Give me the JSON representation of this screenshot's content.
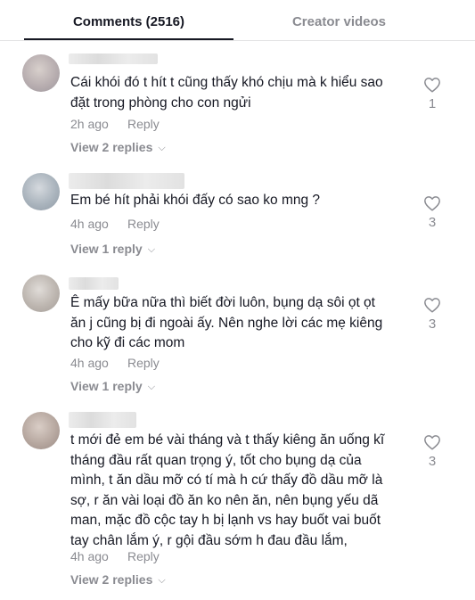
{
  "tabs": {
    "comments": "Comments (2516)",
    "creator": "Creator videos"
  },
  "comments": [
    {
      "lines": [
        "Cái khói đó t hít t cũng thấy khó chịu mà k hiểu sao",
        "đặt trong phòng cho con ngửi"
      ],
      "time": "2h ago",
      "reply": "Reply",
      "replies": "View 2 replies",
      "likes": "1"
    },
    {
      "lines": [
        "Em bé hít phải khói đấy có sao ko mng ?"
      ],
      "time": "4h ago",
      "reply": "Reply",
      "replies": "View 1 reply",
      "likes": "3"
    },
    {
      "lines": [
        "Ê mấy bữa nữa thì biết đời luôn, bụng dạ sôi ọt ọt",
        "ăn j cũng bị đi ngoài ấy. Nên nghe lời các mẹ kiêng",
        "cho kỹ đi các mom"
      ],
      "time": "4h ago",
      "reply": "Reply",
      "replies": "View 1 reply",
      "likes": "3"
    },
    {
      "lines": [
        "t mới đẻ em bé vài tháng và t thấy kiêng ăn uống kĩ",
        "tháng đầu rất quan trọng ý, tốt cho bụng dạ của",
        "mình, t ăn dầu mỡ có tí mà h cứ thấy đồ dầu mỡ là",
        "sợ, r ăn vài loại đồ ăn ko nên ăn, nên bụng yếu dã",
        "man, mặc đồ cộc tay h bị lạnh vs hay buốt vai buốt",
        "tay chân lắm ý, r gội đầu sớm h đau đầu lắm,"
      ],
      "time": "4h ago",
      "reply": "Reply",
      "replies": "View 2 replies",
      "likes": "3"
    }
  ]
}
